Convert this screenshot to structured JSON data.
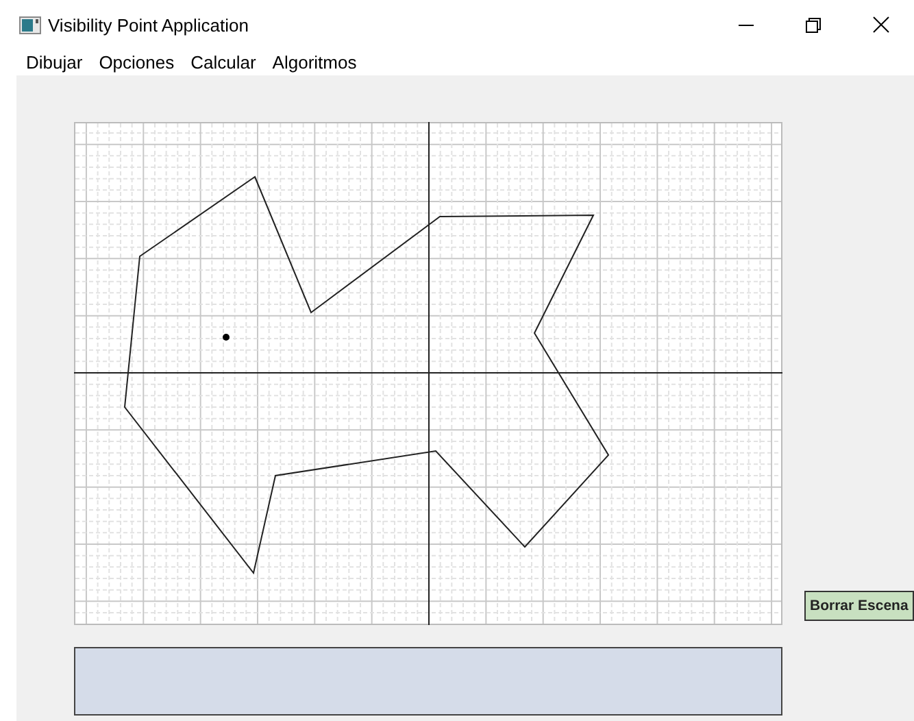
{
  "window": {
    "title": "Visibility Point Application"
  },
  "menu": [
    "Dibujar",
    "Opciones",
    "Calcular",
    "Algoritmos"
  ],
  "buttons": [
    "Borrar Escena"
  ],
  "output_panel": {
    "kind": "empty"
  }
}
